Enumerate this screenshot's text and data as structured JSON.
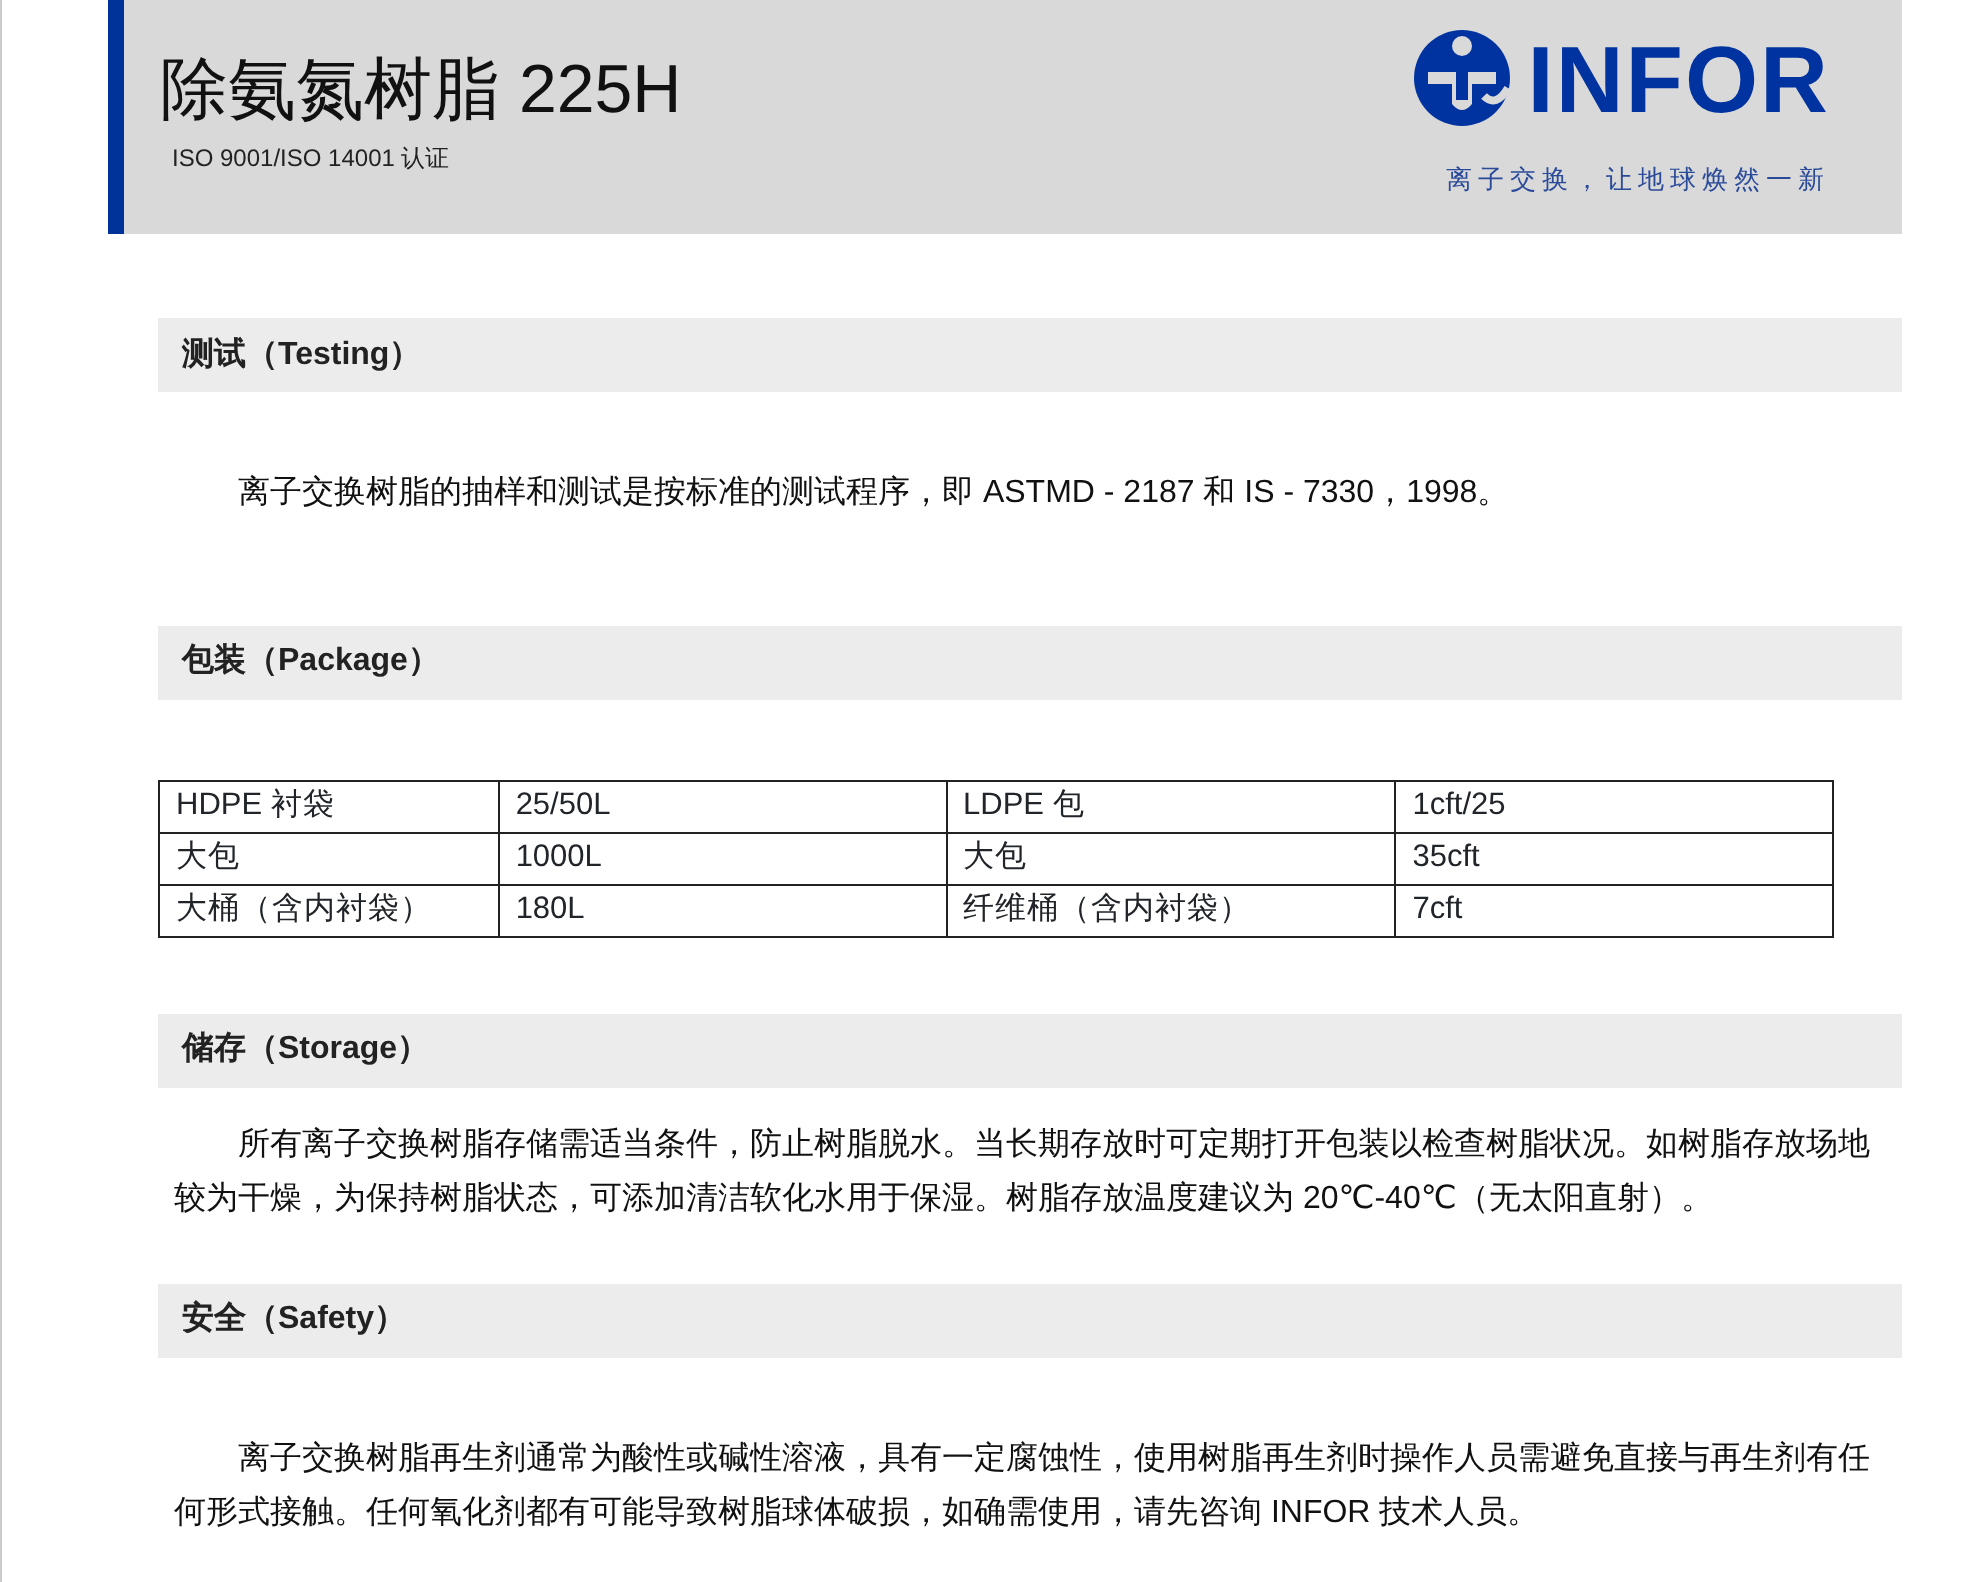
{
  "header": {
    "title": "除氨氮树脂 225H",
    "certification": "ISO 9001/ISO 14001 认证",
    "brand": "INFOR",
    "slogan": "离子交换，让地球焕然一新"
  },
  "sections": [
    {
      "heading": "测试（Testing）",
      "kind": "text",
      "paragraph": "离子交换树脂的抽样和测试是按标准的测试程序，即 ASTMD - 2187 和 IS - 7330，1998。"
    },
    {
      "heading": "包装（Package）",
      "kind": "table",
      "rows": [
        [
          "HDPE 衬袋",
          "25/50L",
          "LDPE 包",
          "1cft/25"
        ],
        [
          "大包",
          "1000L",
          "大包",
          "35cft"
        ],
        [
          "大桶（含内衬袋）",
          "180L",
          "纤维桶（含内衬袋）",
          "7cft"
        ]
      ]
    },
    {
      "heading": "储存（Storage）",
      "kind": "text",
      "paragraph": "所有离子交换树脂存储需适当条件，防止树脂脱水。当长期存放时可定期打开包装以检查树脂状况。如树脂存放场地较为干燥，为保持树脂状态，可添加清洁软化水用于保湿。树脂存放温度建议为 20℃-40℃（无太阳直射）。"
    },
    {
      "heading": "安全（Safety）",
      "kind": "text",
      "paragraph": "离子交换树脂再生剂通常为酸性或碱性溶液，具有一定腐蚀性，使用树脂再生剂时操作人员需避免直接与再生剂有任何形式接触。任何氧化剂都有可能导致树脂球体破损，如确需使用，请先咨询 INFOR 技术人员。"
    }
  ]
}
